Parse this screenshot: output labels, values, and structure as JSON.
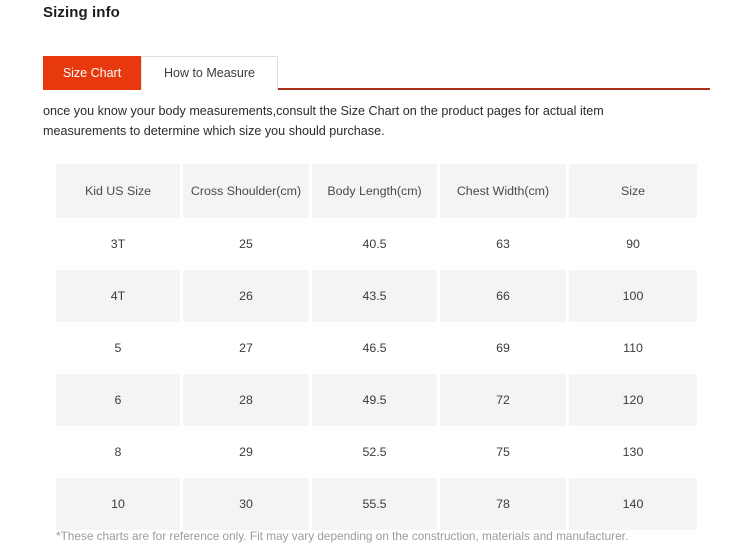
{
  "page": {
    "title": "Sizing info"
  },
  "tabs": [
    {
      "label": "Size Chart",
      "active": true
    },
    {
      "label": "How to Measure",
      "active": false
    }
  ],
  "intro": {
    "text": "once you know your body measurements,consult the Size Chart on the product pages for actual item measurements to determine which size you should purchase."
  },
  "table": {
    "headers": [
      "Kid US Size",
      "Cross Shoulder(cm)",
      "Body Length(cm)",
      "Chest Width(cm)",
      "Size"
    ],
    "rows": [
      [
        "3T",
        "25",
        "40.5",
        "63",
        "90"
      ],
      [
        "4T",
        "26",
        "43.5",
        "66",
        "100"
      ],
      [
        "5",
        "27",
        "46.5",
        "69",
        "110"
      ],
      [
        "6",
        "28",
        "49.5",
        "72",
        "120"
      ],
      [
        "8",
        "29",
        "52.5",
        "75",
        "130"
      ],
      [
        "10",
        "30",
        "55.5",
        "78",
        "140"
      ]
    ]
  },
  "footnote": {
    "text": "*These charts are for reference only. Fit may vary depending on the construction, materials and manufacturer."
  },
  "colors": {
    "accent": "#e8380d",
    "underline": "#a8311a",
    "row_alt": "#f4f4f4",
    "header_bg": "#f4f4f4"
  }
}
